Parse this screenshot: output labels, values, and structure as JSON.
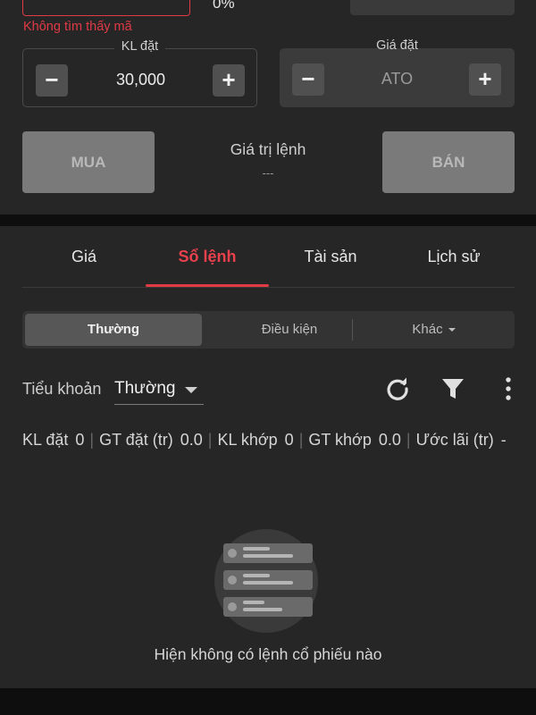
{
  "order_form": {
    "code_percent": "0%",
    "error_message": "Không tìm thấy mã",
    "quantity": {
      "label": "KL đặt",
      "value": "30,000",
      "minus": "−",
      "plus": "+"
    },
    "price": {
      "label": "Giá đặt",
      "value": "ATO",
      "minus": "−",
      "plus": "+"
    },
    "buy_label": "MUA",
    "sell_label": "BÁN",
    "order_value_label": "Giá trị lệnh",
    "order_value": "---"
  },
  "tabs": [
    {
      "label": "Giá",
      "active": false
    },
    {
      "label": "Sổ lệnh",
      "active": true
    },
    {
      "label": "Tài sản",
      "active": false
    },
    {
      "label": "Lịch sử",
      "active": false
    }
  ],
  "order_type": {
    "normal": "Thường",
    "conditional": "Điều kiện",
    "other": "Khác"
  },
  "sub_account": {
    "label": "Tiểu khoản",
    "value": "Thường"
  },
  "icons": {
    "refresh": "refresh-icon",
    "filter": "filter-icon",
    "more": "more-vertical-icon"
  },
  "summary": {
    "qty_label": "KL đặt",
    "qty_value": "0",
    "value_label": "GT đặt (tr)",
    "value_value": "0.0",
    "matched_qty_label": "KL khớp",
    "matched_qty_value": "0",
    "matched_value_label": "GT khớp",
    "matched_value_value": "0.0",
    "est_profit_label": "Ước lãi (tr)",
    "est_profit_value": "-"
  },
  "empty_state": {
    "message": "Hiện không có lệnh cổ phiếu nào"
  },
  "colors": {
    "accent": "#e03a45",
    "panel": "#262626",
    "background": "#0e0e0f"
  }
}
